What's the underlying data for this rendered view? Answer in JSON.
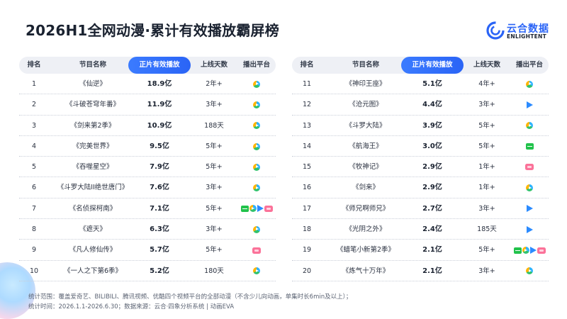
{
  "title": "2026H1全网动漫·累计有效播放霸屏榜",
  "logo": {
    "cn": "云合数据",
    "en": "ENLIGHTENT"
  },
  "headers": {
    "rank": "排名",
    "name": "节目名称",
    "play": "正片有效播放",
    "days": "上线天数",
    "platform": "播出平台"
  },
  "icons": {
    "tencent": "tencent-video-icon",
    "youku": "youku-icon",
    "iqiyi": "iqiyi-icon",
    "bili": "bilibili-icon"
  },
  "colors": {
    "accent": "#2a64f6",
    "tencent": "#2fb3ff",
    "youku": "#2b8bff",
    "iqiyi": "#21c24b",
    "bilibili": "#fb7299"
  },
  "chart_data": {
    "type": "table",
    "columns": [
      "排名",
      "节目名称",
      "正片有效播放",
      "上线天数",
      "播出平台"
    ],
    "rows": [
      {
        "rank": "1",
        "name": "《仙逆》",
        "play": "18.9亿",
        "days": "2年+",
        "platforms": [
          "tencent"
        ]
      },
      {
        "rank": "2",
        "name": "《斗破苍穹年番》",
        "play": "11.9亿",
        "days": "3年+",
        "platforms": [
          "tencent"
        ]
      },
      {
        "rank": "3",
        "name": "《剑来第2季》",
        "play": "10.9亿",
        "days": "188天",
        "platforms": [
          "tencent"
        ]
      },
      {
        "rank": "4",
        "name": "《完美世界》",
        "play": "9.5亿",
        "days": "5年+",
        "platforms": [
          "tencent"
        ]
      },
      {
        "rank": "5",
        "name": "《吞噬星空》",
        "play": "7.9亿",
        "days": "5年+",
        "platforms": [
          "tencent"
        ]
      },
      {
        "rank": "6",
        "name": "《斗罗大陆II绝世唐门》",
        "play": "7.6亿",
        "days": "3年+",
        "platforms": [
          "tencent"
        ]
      },
      {
        "rank": "7",
        "name": "《名侦探柯南》",
        "play": "7.1亿",
        "days": "5年+",
        "platforms": [
          "iqiyi",
          "tencent",
          "youku",
          "bili"
        ]
      },
      {
        "rank": "8",
        "name": "《遮天》",
        "play": "6.3亿",
        "days": "3年+",
        "platforms": [
          "tencent"
        ]
      },
      {
        "rank": "9",
        "name": "《凡人修仙传》",
        "play": "5.7亿",
        "days": "5年+",
        "platforms": [
          "bili"
        ]
      },
      {
        "rank": "10",
        "name": "《一人之下第6季》",
        "play": "5.2亿",
        "days": "180天",
        "platforms": [
          "tencent"
        ]
      },
      {
        "rank": "11",
        "name": "《神印王座》",
        "play": "5.1亿",
        "days": "4年+",
        "platforms": [
          "tencent"
        ]
      },
      {
        "rank": "12",
        "name": "《沧元图》",
        "play": "4.4亿",
        "days": "3年+",
        "platforms": [
          "youku"
        ]
      },
      {
        "rank": "13",
        "name": "《斗罗大陆》",
        "play": "3.9亿",
        "days": "5年+",
        "platforms": [
          "tencent"
        ]
      },
      {
        "rank": "14",
        "name": "《航海王》",
        "play": "3.0亿",
        "days": "5年+",
        "platforms": [
          "iqiyi"
        ]
      },
      {
        "rank": "15",
        "name": "《牧神记》",
        "play": "2.9亿",
        "days": "1年+",
        "platforms": [
          "bili"
        ]
      },
      {
        "rank": "16",
        "name": "《剑来》",
        "play": "2.9亿",
        "days": "1年+",
        "platforms": [
          "tencent"
        ]
      },
      {
        "rank": "17",
        "name": "《师兄啊师兄》",
        "play": "2.7亿",
        "days": "3年+",
        "platforms": [
          "youku"
        ]
      },
      {
        "rank": "18",
        "name": "《光阴之外》",
        "play": "2.4亿",
        "days": "185天",
        "platforms": [
          "youku"
        ]
      },
      {
        "rank": "19",
        "name": "《蜡笔小新第2季》",
        "play": "2.1亿",
        "days": "5年+",
        "platforms": [
          "iqiyi",
          "tencent",
          "youku",
          "bili"
        ]
      },
      {
        "rank": "20",
        "name": "《炼气十万年》",
        "play": "2.1亿",
        "days": "3年+",
        "platforms": [
          "tencent"
        ]
      }
    ]
  },
  "footer": {
    "line1": "统计范围：覆盖爱奇艺、BILIBILI、腾讯视频、优酷四个视频平台的全部动漫（不含少儿向动画，单集时长6min及以上）；",
    "line2": "统计时间：2026.1.1-2026.6.30；数据来源：云合·四象分析系统 | 动画EVA"
  }
}
